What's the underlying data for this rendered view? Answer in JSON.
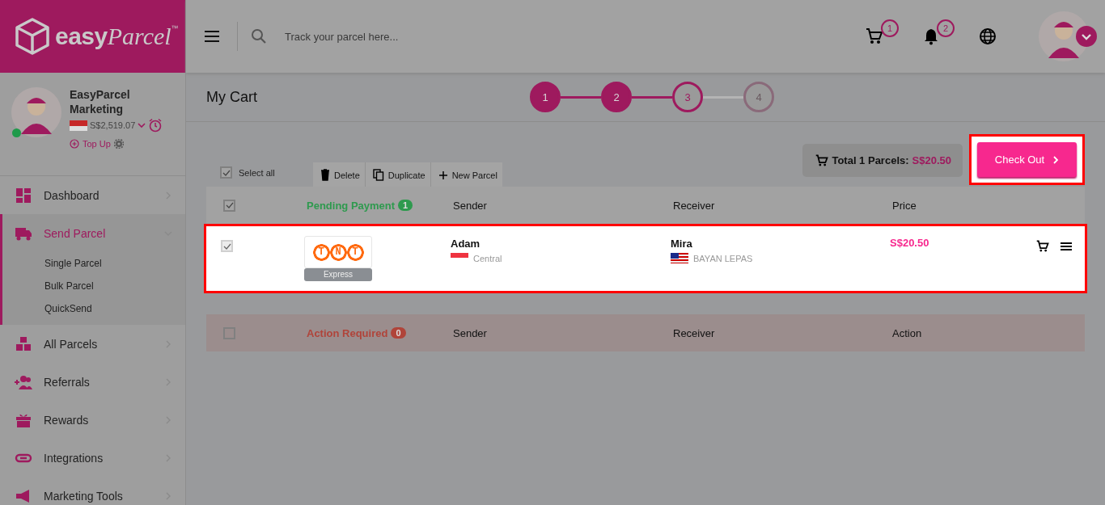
{
  "logo": {
    "word1": "easy",
    "word2": "Parcel",
    "mark": "™"
  },
  "header": {
    "search": {
      "placeholder": "Track your parcel here..."
    },
    "cart_count": "1",
    "notification_count": "2"
  },
  "account": {
    "name": "EasyParcel Marketing",
    "online": true,
    "balance": "S$2,519.07",
    "top_up": "Top Up"
  },
  "sidebar": {
    "items": [
      {
        "label": "Dashboard",
        "selected": false,
        "expanded": false
      },
      {
        "label": "Send Parcel",
        "selected": true,
        "expanded": true,
        "children": [
          {
            "label": "Single Parcel"
          },
          {
            "label": "Bulk Parcel"
          },
          {
            "label": "QuickSend"
          }
        ]
      },
      {
        "label": "All Parcels",
        "selected": false,
        "expanded": false
      },
      {
        "label": "Referrals",
        "selected": false,
        "expanded": false
      },
      {
        "label": "Rewards",
        "selected": false,
        "expanded": false
      },
      {
        "label": "Integrations",
        "selected": false,
        "expanded": false
      },
      {
        "label": "Marketing Tools",
        "selected": false,
        "expanded": false
      }
    ]
  },
  "page": {
    "title": "My Cart"
  },
  "steps": [
    {
      "label": "1",
      "completed": true,
      "selected": false
    },
    {
      "label": "2",
      "completed": true,
      "selected": false
    },
    {
      "label": "3",
      "completed": false,
      "selected": true
    },
    {
      "label": "4",
      "completed": false,
      "selected": false
    }
  ],
  "toolbar": {
    "select_all": {
      "label": "Select all",
      "checked": true
    },
    "buttons": [
      {
        "label": "Delete"
      },
      {
        "label": "Duplicate"
      },
      {
        "label": "New Parcel"
      }
    ]
  },
  "total": {
    "label": "Total 1 Parcels:",
    "amount": "S$20.50"
  },
  "checkout": {
    "label": "Check Out",
    "highlighted": true
  },
  "groups": [
    {
      "kind": "pending",
      "title": "Pending Payment",
      "count": "1",
      "color": "#2e9a4e",
      "checked": true,
      "columns": [
        "Sender",
        "Receiver",
        "Price"
      ],
      "rows": [
        {
          "checked": true,
          "highlighted": true,
          "carrier": "TNT",
          "service": "Express",
          "sender": "Adam",
          "sender_area": "Central",
          "receiver": "Mira",
          "receiver_area": "BAYAN LEPAS",
          "price": "S$20.50"
        }
      ]
    },
    {
      "kind": "action",
      "title": "Action Required",
      "count": "0",
      "color": "#b0443a",
      "checked": false,
      "columns": [
        "Sender",
        "Receiver",
        "Action"
      ]
    }
  ]
}
